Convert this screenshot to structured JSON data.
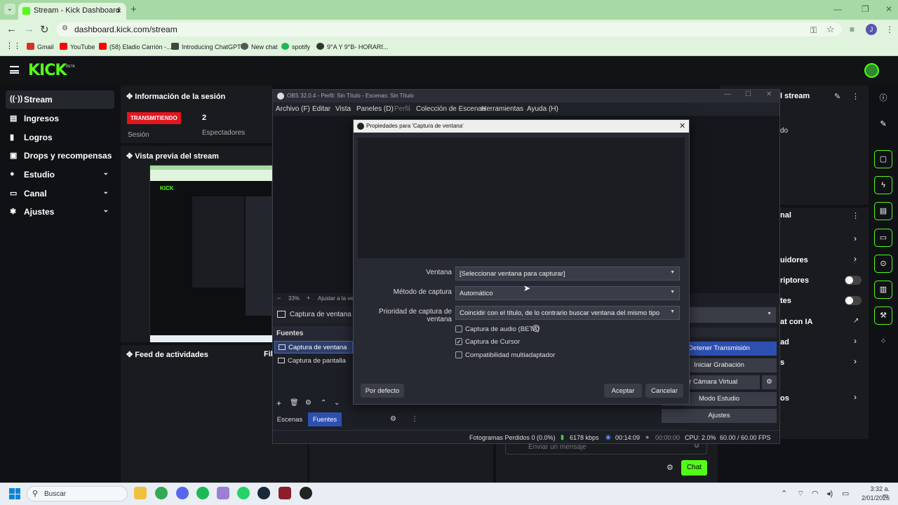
{
  "browser": {
    "tab_title": "Stream - Kick Dashboard",
    "url": "dashboard.kick.com/stream",
    "profile_initial": "J",
    "bookmarks": [
      {
        "label": "Gmail",
        "color": "#d93025"
      },
      {
        "label": "YouTube",
        "color": "#ff0000"
      },
      {
        "label": "(58) Eladio Carrión -...",
        "color": "#ff0000"
      },
      {
        "label": "Introducing ChatGPT",
        "color": "#444444"
      },
      {
        "label": "New chat",
        "color": "#555555"
      },
      {
        "label": "spotify",
        "color": "#1db954"
      },
      {
        "label": "9°A Y 9°B- HORARI...",
        "color": "#333333"
      }
    ]
  },
  "kick": {
    "logo": "KICK",
    "beta": "BETA",
    "accent": "#53fc18",
    "sidebar": [
      {
        "label": "Stream",
        "icon": "radio-icon"
      },
      {
        "label": "Ingresos",
        "icon": "dollar-icon"
      },
      {
        "label": "Logros",
        "icon": "trophy-icon"
      },
      {
        "label": "Drops y recompensas",
        "icon": "gift-icon"
      },
      {
        "label": "Estudio",
        "icon": "brush-icon"
      },
      {
        "label": "Canal",
        "icon": "tv-icon"
      },
      {
        "label": "Ajustes",
        "icon": "gear-icon"
      }
    ],
    "session": {
      "title": "Información de la sesión",
      "live_badge": "TRANSMITIENDO",
      "session_label": "Sesión",
      "viewers": "2",
      "viewers_label": "Espectadores"
    },
    "preview_title": "Vista previa del stream",
    "feed_title": "Feed de actividades",
    "feed_filter": "Fil",
    "chat_placeholder": "Enviar un mensaje",
    "chat_button": "Chat",
    "right_panel": {
      "stream_title": "l stream",
      "mode": "do",
      "canal_title": "nal",
      "items": [
        "uidores",
        "riptores",
        "tes",
        "at con IA",
        "ad",
        "s",
        "os"
      ]
    }
  },
  "obs": {
    "title": "OBS 32.0.4 - Perfil: Sin Título - Escenas: Sin Título",
    "menu": [
      "Archivo (F)",
      "Editar",
      "Vista",
      "Paneles (D)",
      "Perfil",
      "Colección de Escenas",
      "Herramientas",
      "Ayuda (H)"
    ],
    "zoom": "33%",
    "fit": "Ajustar a la ve",
    "current_source": "Captura de ventana",
    "sources_header": "Fuentes",
    "sources": [
      "Captura de ventana",
      "Captura de pantalla"
    ],
    "bottom_tabs": [
      "Escenas",
      "Fuentes"
    ],
    "controls": [
      "Detener Transmisión",
      "Iniciar Grabación",
      "iar Cámara Virtual",
      "Modo Estudio",
      "Ajustes"
    ],
    "status": {
      "dropped": "Fotogramas Perdidos 0 (0.0%)",
      "kbps": "6178 kbps",
      "live_time": "00:14:09",
      "rec_time": "00:00:00",
      "cpu": "CPU: 2.0%",
      "fps": "60.00 / 60.00 FPS"
    },
    "dialog": {
      "title": "Propiedades para 'Captura de ventana'",
      "ventana_label": "Ventana",
      "ventana_value": "[Seleccionar ventana para capturar]",
      "metodo_label": "Método de captura",
      "metodo_value": "Automático",
      "prioridad_label": "Prioridad de captura de ventana",
      "prioridad_value": "Coincidir con el título, de lo contrario buscar ventana del mismo tipo",
      "checks": [
        {
          "label": "Captura de audio (BETA)",
          "checked": false
        },
        {
          "label": "Captura de Cursor",
          "checked": true
        },
        {
          "label": "Compatibilidad multiadaptador",
          "checked": false
        }
      ],
      "defaults_btn": "Por defecto",
      "ok_btn": "Aceptar",
      "cancel_btn": "Cancelar"
    }
  },
  "taskbar": {
    "search": "Buscar",
    "time": "3:32 a. m.",
    "date": "2/01/2026"
  }
}
